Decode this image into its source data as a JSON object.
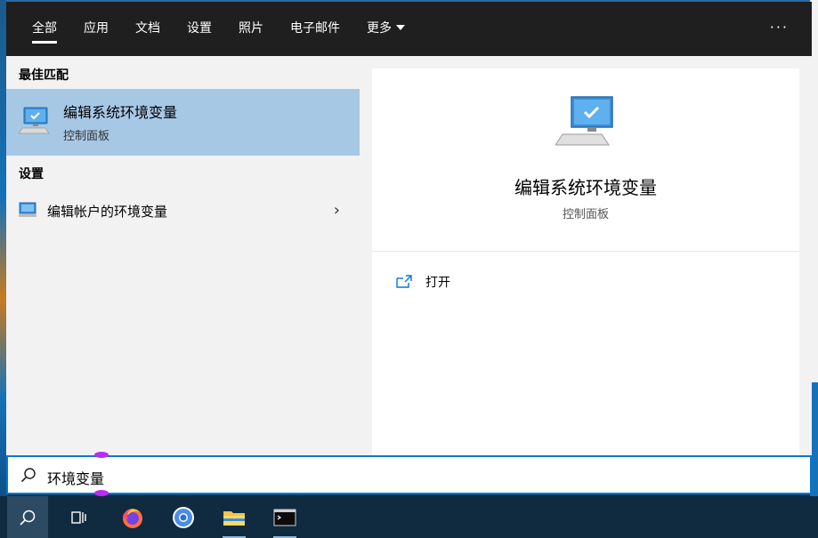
{
  "tabs": [
    {
      "label": "全部"
    },
    {
      "label": "应用"
    },
    {
      "label": "文档"
    },
    {
      "label": "设置"
    },
    {
      "label": "照片"
    },
    {
      "label": "电子邮件"
    },
    {
      "label": "更多"
    }
  ],
  "more_menu": {
    "label": "···"
  },
  "best_match": {
    "heading": "最佳匹配",
    "title": "编辑系统环境变量",
    "subtitle": "控制面板"
  },
  "settings": {
    "heading": "设置",
    "item_label": "编辑帐户的环境变量",
    "chevron": "›"
  },
  "preview": {
    "title": "编辑系统环境变量",
    "subtitle": "控制面板",
    "open_label": "打开"
  },
  "search": {
    "value": "环境变量"
  },
  "colors": {
    "accent": "#0078d7",
    "selection": "#a7c8e5",
    "tabbar": "#1f1f1f",
    "taskbar": "#102a3f",
    "cursor_marker": "#b92df2"
  },
  "taskbar_icons": [
    "search-icon",
    "task-view-icon",
    "firefox-icon",
    "chromium-icon",
    "file-explorer-icon",
    "terminal-icon"
  ]
}
